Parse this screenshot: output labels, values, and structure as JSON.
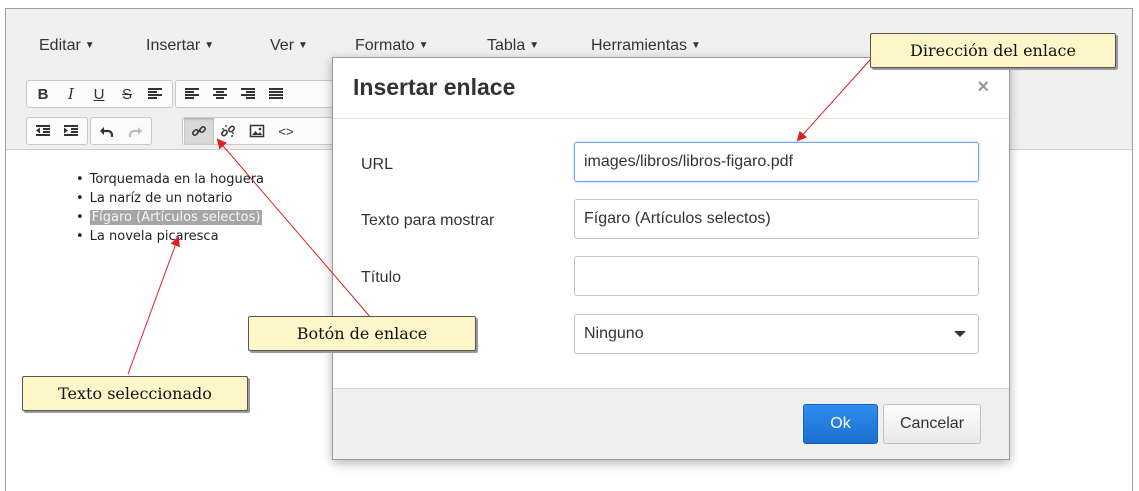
{
  "menubar": {
    "items": [
      {
        "label": "Editar"
      },
      {
        "label": "Insertar"
      },
      {
        "label": "Ver"
      },
      {
        "label": "Formato"
      },
      {
        "label": "Tabla"
      },
      {
        "label": "Herramientas"
      }
    ]
  },
  "toolbar": {
    "bold": "B",
    "italic": "I",
    "underline": "U",
    "strikethrough": "S",
    "code": "<>"
  },
  "content": {
    "list": [
      "Torquemada en la hoguera",
      "La naríz de un notario",
      "Fígaro (Artículos selectos)",
      "La novela picaresca"
    ],
    "selected_index": 2
  },
  "dialog": {
    "title": "Insertar enlace",
    "close": "×",
    "fields": {
      "url_label": "URL",
      "url_value": "images/libros/libros-figaro.pdf",
      "text_label": "Texto para mostrar",
      "text_value": "Fígaro (Artículos selectos)",
      "title_label": "Título",
      "title_value": "",
      "target_value": "Ninguno"
    },
    "ok": "Ok",
    "cancel": "Cancelar"
  },
  "callouts": {
    "link_address": "Dirección del enlace",
    "link_button": "Botón de enlace",
    "selected_text": "Texto seleccionado"
  },
  "colors": {
    "accent": "#1c6fcf",
    "callout_bg": "#fdf6c9",
    "arrow": "#e02020"
  }
}
